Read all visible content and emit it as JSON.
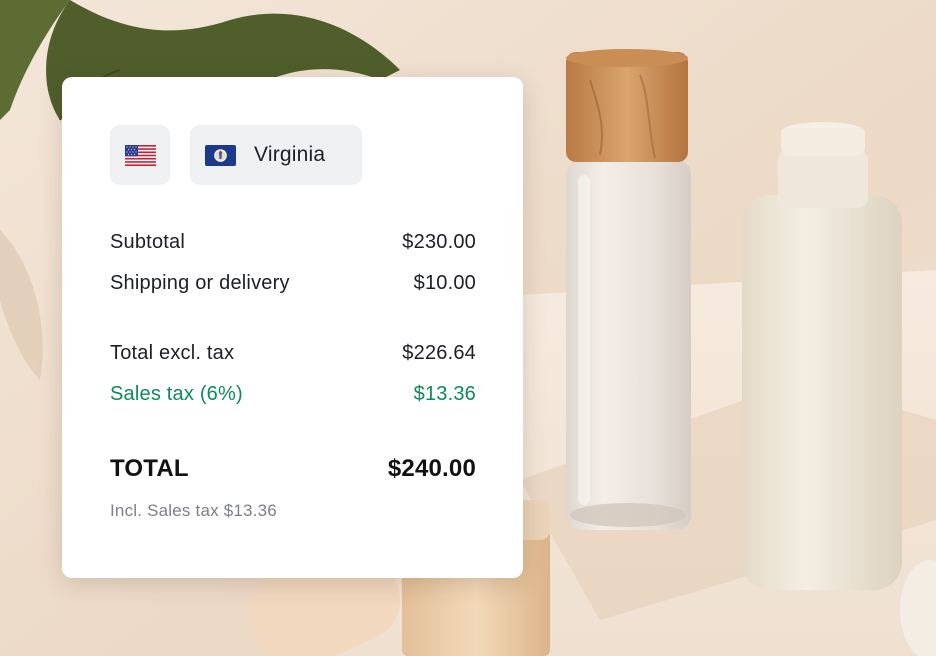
{
  "location": {
    "country_icon": "us-flag-icon",
    "state_icon": "virginia-flag-icon",
    "state_label": "Virginia"
  },
  "summary": {
    "subtotal": {
      "label": "Subtotal",
      "value": "$230.00"
    },
    "shipping": {
      "label": "Shipping or delivery",
      "value": "$10.00"
    },
    "total_excl_tax": {
      "label": "Total excl. tax",
      "value": "$226.64"
    },
    "sales_tax": {
      "label": "Sales tax (6%)",
      "value": "$13.36"
    },
    "total": {
      "label": "TOTAL",
      "value": "$240.00"
    },
    "tax_note": "Incl. Sales tax $13.36"
  },
  "colors": {
    "tax_green": "#0d8a5b",
    "card_bg": "#ffffff",
    "chip_bg": "#eff0f2",
    "virginia_blue": "#1d3a8a"
  }
}
